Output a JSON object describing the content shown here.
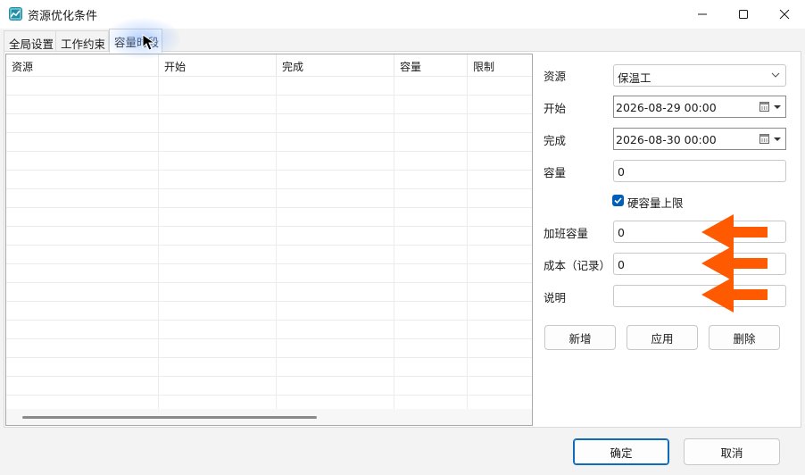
{
  "window": {
    "title": "资源优化条件"
  },
  "tabs": [
    {
      "label": "全局设置"
    },
    {
      "label": "工作约束"
    },
    {
      "label": "容量时段"
    }
  ],
  "table": {
    "columns": [
      "资源",
      "开始",
      "完成",
      "容量",
      "限制"
    ],
    "rows": []
  },
  "form": {
    "resource": {
      "label": "资源",
      "value": "保温工"
    },
    "start": {
      "label": "开始",
      "value": "2026-08-29 00:00"
    },
    "finish": {
      "label": "完成",
      "value": "2026-08-30 00:00"
    },
    "capacity": {
      "label": "容量",
      "value": "0"
    },
    "hard_limit": {
      "label": "硬容量上限",
      "checked": true
    },
    "overtime_capacity": {
      "label": "加班容量",
      "value": "0"
    },
    "cost": {
      "label": "成本（记录）",
      "value": "0"
    },
    "description": {
      "label": "说明",
      "value": ""
    }
  },
  "actions": {
    "add": "新增",
    "apply": "应用",
    "delete": "删除"
  },
  "dialog": {
    "ok": "确定",
    "cancel": "取消"
  },
  "colors": {
    "accent": "#0f6cbd",
    "annotation_arrow": "#ff5a00"
  },
  "icons": [
    "app-icon",
    "minimize-icon",
    "maximize-icon",
    "close-icon",
    "chevron-down-icon",
    "calendar-icon",
    "checkmark-icon",
    "mouse-cursor-icon",
    "annotation-arrow-icon"
  ]
}
